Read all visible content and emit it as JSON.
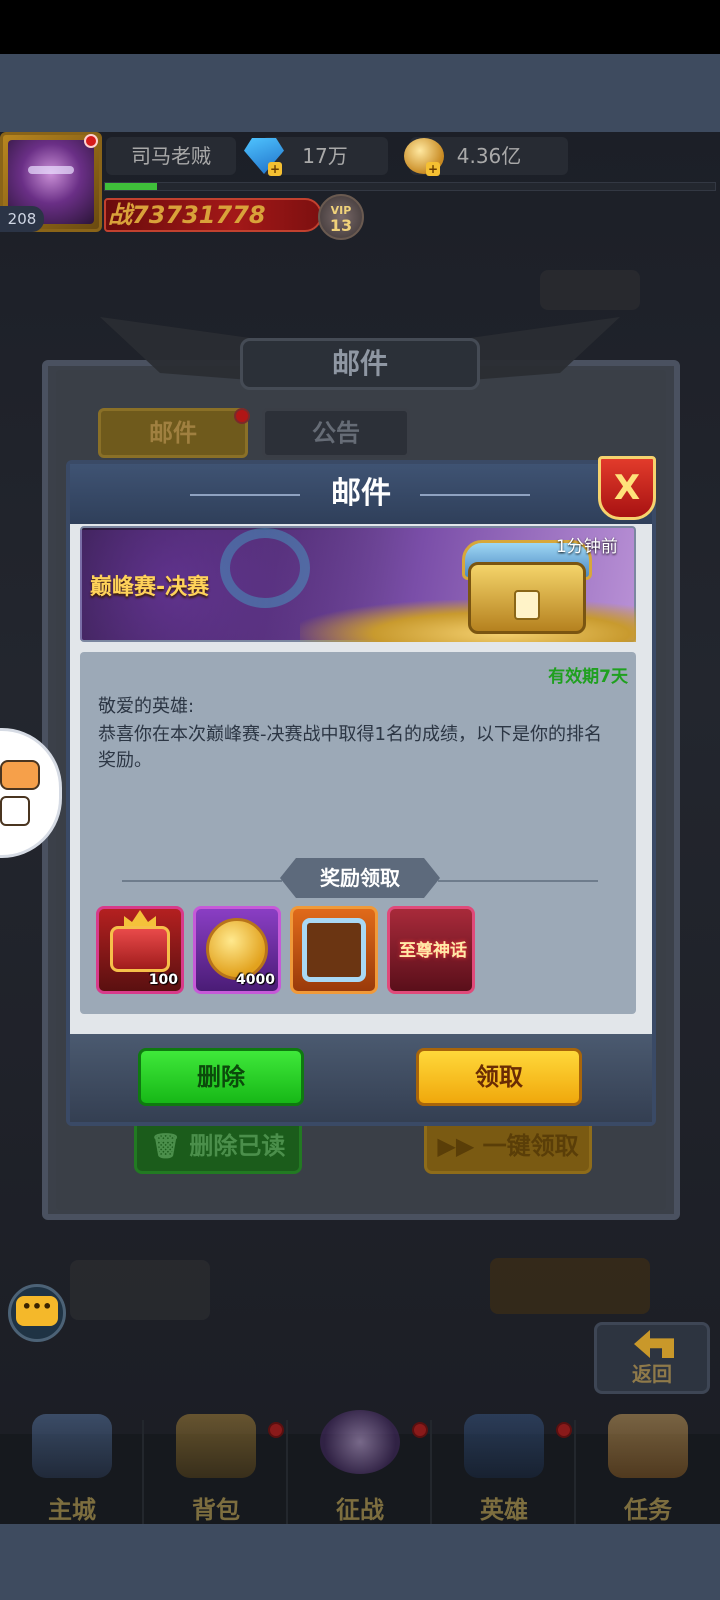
{
  "player": {
    "name": "司马老贼",
    "level": "208",
    "gems": "17万",
    "gold": "4.36亿",
    "power": "战73731778",
    "vip_label": "VIP",
    "vip_level": "13",
    "xp_progress": 0.09
  },
  "mail_panel": {
    "title": "邮件",
    "tabs": [
      {
        "label": "邮件",
        "badge": true,
        "active": true
      },
      {
        "label": "公告",
        "badge": false,
        "active": false
      }
    ],
    "delete_read_label": "删除已读",
    "claim_all_label": "一键领取"
  },
  "modal": {
    "title": "邮件",
    "close_label": "X",
    "banner_title": "巅峰赛-决赛",
    "timestamp": "1分钟前",
    "validity": "有效期7天",
    "greeting": "敬爱的英雄:",
    "message": "恭喜你在本次巅峰赛-决赛战中取得1名的成绩，以下是你的排名奖励。",
    "rewards_header": "奖励领取",
    "rewards": [
      {
        "icon": "treasure-chest-icon",
        "count": "100"
      },
      {
        "icon": "gold-coin-icon",
        "count": "4000"
      },
      {
        "icon": "avatar-frame-icon",
        "count": ""
      },
      {
        "icon": "title-badge-icon",
        "text": "至尊神话"
      }
    ],
    "delete_label": "删除",
    "claim_label": "领取"
  },
  "widgets": {
    "chat_icon": "chat-bubble-icon",
    "chat_glyph": "•••",
    "back_label": "返回"
  },
  "nav": [
    {
      "label": "主城",
      "badge": false
    },
    {
      "label": "背包",
      "badge": true
    },
    {
      "label": "征战",
      "badge": true
    },
    {
      "label": "英雄",
      "badge": true
    },
    {
      "label": "任务",
      "badge": false
    }
  ],
  "colors": {
    "delete_button": "#17b817",
    "claim_button": "#f0a80c",
    "close_button": "#c41a1a",
    "validity_text": "#1fa01f",
    "banner_title": "#ffd35a"
  }
}
